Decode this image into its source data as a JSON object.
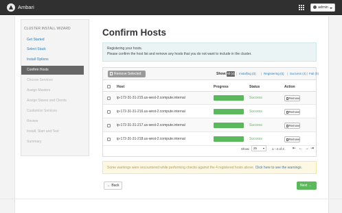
{
  "header": {
    "app_title": "Ambari",
    "logo_icon": "ambari-logo-icon",
    "apps_icon": "grid-icon",
    "user_label": "admin"
  },
  "sidebar": {
    "title": "CLUSTER INSTALL WIZARD",
    "steps": [
      {
        "label": "Get Started",
        "state": "done"
      },
      {
        "label": "Select Stack",
        "state": "done"
      },
      {
        "label": "Install Options",
        "state": "done"
      },
      {
        "label": "Confirm Hosts",
        "state": "active"
      },
      {
        "label": "Choose Services",
        "state": "pending"
      },
      {
        "label": "Assign Masters",
        "state": "pending"
      },
      {
        "label": "Assign Slaves and Clients",
        "state": "pending"
      },
      {
        "label": "Customize Services",
        "state": "pending"
      },
      {
        "label": "Review",
        "state": "pending"
      },
      {
        "label": "Install, Start and Test",
        "state": "pending"
      },
      {
        "label": "Summary",
        "state": "pending"
      }
    ]
  },
  "main": {
    "title": "Confirm Hosts",
    "info_line1": "Registering your hosts.",
    "info_line2": "Please confirm the host list and remove any hosts that you do not want to include in the cluster.",
    "remove_selected_label": "Remove Selected",
    "show_label": "Show:",
    "filters": {
      "all": "All (4)",
      "installing": "Installing (0)",
      "registering": "Registering (0)",
      "success": "Success (4)",
      "fail": "Fail (0)"
    },
    "columns": {
      "host": "Host",
      "progress": "Progress",
      "status": "Status",
      "action": "Action"
    },
    "hosts": [
      {
        "name": "ip-172-31-31-215.us-west-2.compute.internal",
        "progress": 1.0,
        "status": "Success",
        "action": "Remove"
      },
      {
        "name": "ip-172-31-31-216.us-west-2.compute.internal",
        "progress": 1.0,
        "status": "Success",
        "action": "Remove"
      },
      {
        "name": "ip-172-31-31-217.us-west-2.compute.internal",
        "progress": 1.0,
        "status": "Success",
        "action": "Remove"
      },
      {
        "name": "ip-172-31-31-218.us-west-2.compute.internal",
        "progress": 1.0,
        "status": "Success",
        "action": "Remove"
      }
    ],
    "pager": {
      "show_label": "Show:",
      "page_size": "25",
      "range": "1 - 4 of 4"
    },
    "warning_text": "Some warnings were encountered while performing checks against the 4 registered hosts above.",
    "warning_link": "Click here to see the warnings.",
    "back_label": "← Back",
    "next_label": "Next →"
  },
  "colors": {
    "topbar": "#303030",
    "active_step": "#666666",
    "success": "#5cb85c",
    "link": "#337ab7",
    "info_bg": "#eaf4f5",
    "warning_bg": "#fcf8e3"
  }
}
